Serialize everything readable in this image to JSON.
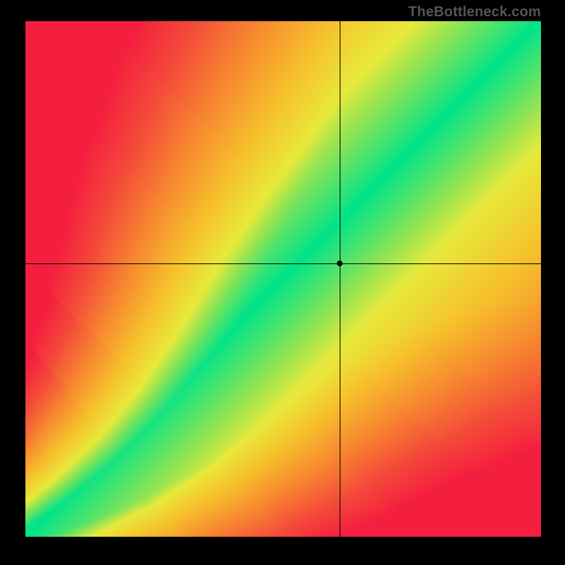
{
  "watermark": "TheBottleneck.com",
  "chart_data": {
    "type": "heatmap",
    "title": "",
    "xlabel": "",
    "ylabel": "",
    "xlim": [
      0,
      1
    ],
    "ylim": [
      0,
      1
    ],
    "crosshair": {
      "x": 0.61,
      "y": 0.53
    },
    "optimal_band": {
      "description": "Green optimal diagonal band with S-shaped centerline; color grades from green (on-band) through yellow/orange to red (far from band).",
      "centerline": [
        {
          "x": 0.0,
          "y": 0.0
        },
        {
          "x": 0.1,
          "y": 0.06
        },
        {
          "x": 0.2,
          "y": 0.13
        },
        {
          "x": 0.3,
          "y": 0.22
        },
        {
          "x": 0.4,
          "y": 0.33
        },
        {
          "x": 0.5,
          "y": 0.45
        },
        {
          "x": 0.6,
          "y": 0.56
        },
        {
          "x": 0.7,
          "y": 0.66
        },
        {
          "x": 0.8,
          "y": 0.76
        },
        {
          "x": 0.9,
          "y": 0.86
        },
        {
          "x": 1.0,
          "y": 0.97
        }
      ],
      "band_half_width_start": 0.012,
      "band_half_width_end": 0.09
    },
    "color_stops": [
      {
        "t": 0.0,
        "color": "#00e38a"
      },
      {
        "t": 0.12,
        "color": "#7de35a"
      },
      {
        "t": 0.22,
        "color": "#e8e93b"
      },
      {
        "t": 0.38,
        "color": "#f6c22c"
      },
      {
        "t": 0.58,
        "color": "#f78a2f"
      },
      {
        "t": 0.8,
        "color": "#f44a3a"
      },
      {
        "t": 1.0,
        "color": "#f41f3e"
      }
    ]
  }
}
